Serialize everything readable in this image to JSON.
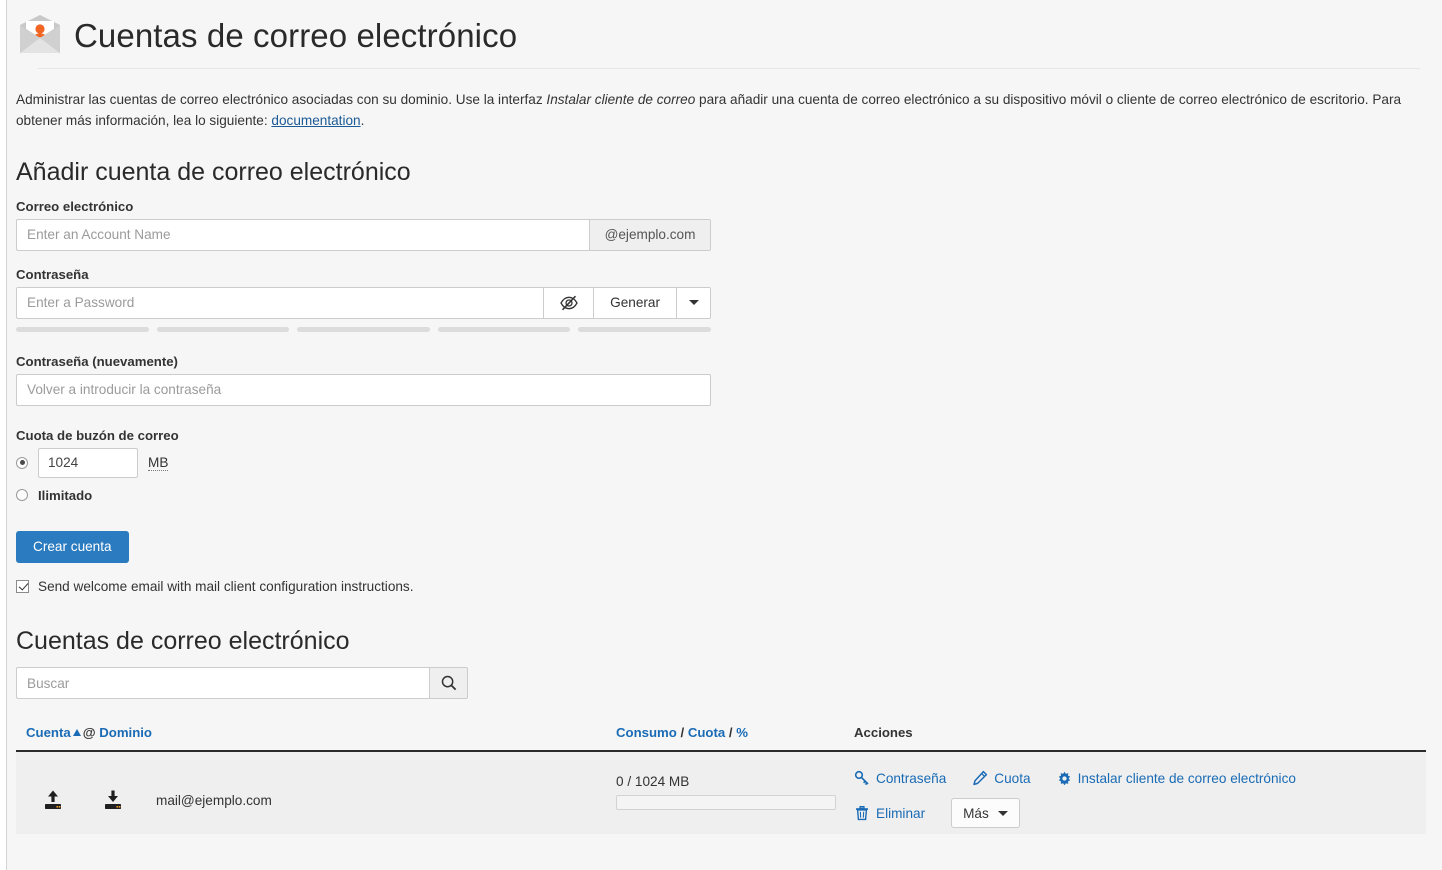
{
  "header": {
    "title": "Cuentas de correo electrónico",
    "icon": "envelope-user-icon"
  },
  "description": {
    "part1": "Administrar las cuentas de correo electrónico asociadas con su dominio. Use la interfaz ",
    "emphasis": "Instalar cliente de correo",
    "part2": " para añadir una cuenta de correo electrónico a su dispositivo móvil o cliente de correo electrónico de escritorio. Para obtener más información, lea lo siguiente: ",
    "link": "documentation",
    "part3": "."
  },
  "add_account": {
    "section_title": "Añadir cuenta de correo electrónico",
    "email_label": "Correo electrónico",
    "email_placeholder": "Enter an Account Name",
    "email_value": "",
    "domain_addon": "@ejemplo.com",
    "password_label": "Contraseña",
    "password_placeholder": "Enter a Password",
    "password_value": "",
    "toggle_visibility_icon": "eye-slash-icon",
    "generate_label": "Generar",
    "generate_caret_icon": "caret-down-icon",
    "strength_segments": 5,
    "strength_filled": 0,
    "password_again_label": "Contraseña (nuevamente)",
    "password_again_placeholder": "Volver a introducir la contraseña",
    "password_again_value": "",
    "quota_label": "Cuota de buzón de correo",
    "quota_value": "1024",
    "quota_unit": "MB",
    "quota_selected": true,
    "unlimited_label": "Ilimitado",
    "unlimited_selected": false,
    "create_button": "Crear cuenta",
    "welcome_checkbox_label": "Send welcome email with mail client configuration instructions.",
    "welcome_checked": true
  },
  "accounts_list": {
    "section_title": "Cuentas de correo electrónico",
    "search_placeholder": "Buscar",
    "search_value": "",
    "search_icon": "search-icon",
    "columns": {
      "account": "Cuenta",
      "at": "@",
      "domain": "Dominio",
      "sort_direction": "ascending",
      "usage": "Consumo",
      "quota": "Cuota",
      "percent": "%",
      "separator": "/",
      "actions": "Acciones"
    },
    "rows": [
      {
        "upload_icon": "upload-icon",
        "download_icon": "download-icon",
        "email": "mail@ejemplo.com",
        "usage_text": "0 / 1024 MB",
        "usage_value": 0,
        "usage_quota": 1024,
        "usage_percent": 0,
        "actions": {
          "password": "Contraseña",
          "password_icon": "key-icon",
          "quota": "Cuota",
          "quota_icon": "pencil-icon",
          "install": "Instalar cliente de correo electrónico",
          "install_icon": "gear-icon",
          "delete": "Eliminar",
          "delete_icon": "trash-icon",
          "more": "Más",
          "more_icon": "caret-down-icon"
        }
      }
    ]
  },
  "colors": {
    "primary_blue": "#2a7bbf",
    "link_blue": "#1a6bb5",
    "page_bg": "#f6f6f6",
    "row_bg": "#efefef",
    "icon_orange": "#f26522"
  }
}
